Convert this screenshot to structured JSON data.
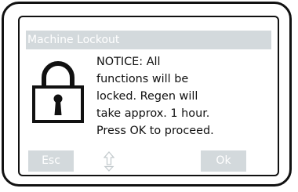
{
  "dialog": {
    "title": "Machine Lockout",
    "message": "NOTICE: All\nfunctions will be\nlocked. Regen will\ntake approx. 1 hour.\nPress OK to proceed."
  },
  "softkeys": {
    "left_label": "Esc",
    "right_label": "Ok"
  },
  "icons": {
    "lock": "padlock-icon",
    "navigation": "up-down-arrow-icon"
  },
  "colors": {
    "bar": "#d3d9dc",
    "bar_text": "#ffffff",
    "outline": "#111111"
  }
}
